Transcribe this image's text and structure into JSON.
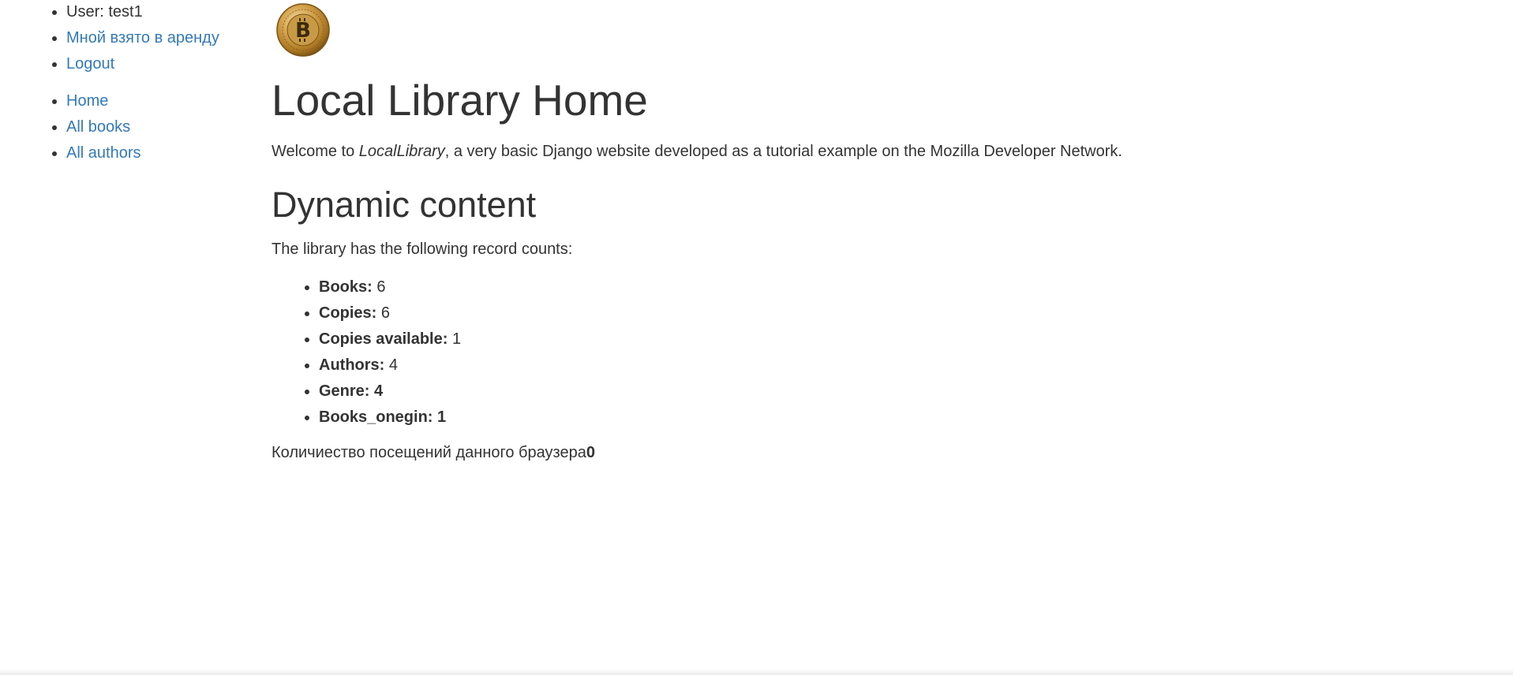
{
  "sidebar": {
    "user_label": "User: test1",
    "account_links": [
      {
        "label": "Мной взято в аренду"
      },
      {
        "label": "Logout"
      }
    ],
    "nav_links": [
      {
        "label": "Home"
      },
      {
        "label": "All books"
      },
      {
        "label": "All authors"
      }
    ],
    "link_color": "#337ab7"
  },
  "main": {
    "logo_icon": "bitcoin-icon",
    "title": "Local Library Home",
    "welcome": {
      "prefix": "Welcome to ",
      "emphasis": "LocalLibrary",
      "suffix": ", a very basic Django website developed as a tutorial example on the Mozilla Developer Network."
    },
    "section_title": "Dynamic content",
    "intro": "The library has the following record counts:",
    "counts": [
      {
        "label": "Books:",
        "value": "6",
        "bold_value": false
      },
      {
        "label": "Copies:",
        "value": "6",
        "bold_value": false
      },
      {
        "label": "Copies available:",
        "value": "1",
        "bold_value": false
      },
      {
        "label": "Authors:",
        "value": "4",
        "bold_value": false
      },
      {
        "label": "Genre:",
        "value": "4",
        "bold_value": true
      },
      {
        "label": "Books_onegin:",
        "value": "1",
        "bold_value": true
      }
    ],
    "visits_label": "Количиество посещений данного браузера",
    "visits_value": "0"
  },
  "colors": {
    "text": "#333333",
    "link": "#337ab7",
    "background": "#ffffff"
  }
}
